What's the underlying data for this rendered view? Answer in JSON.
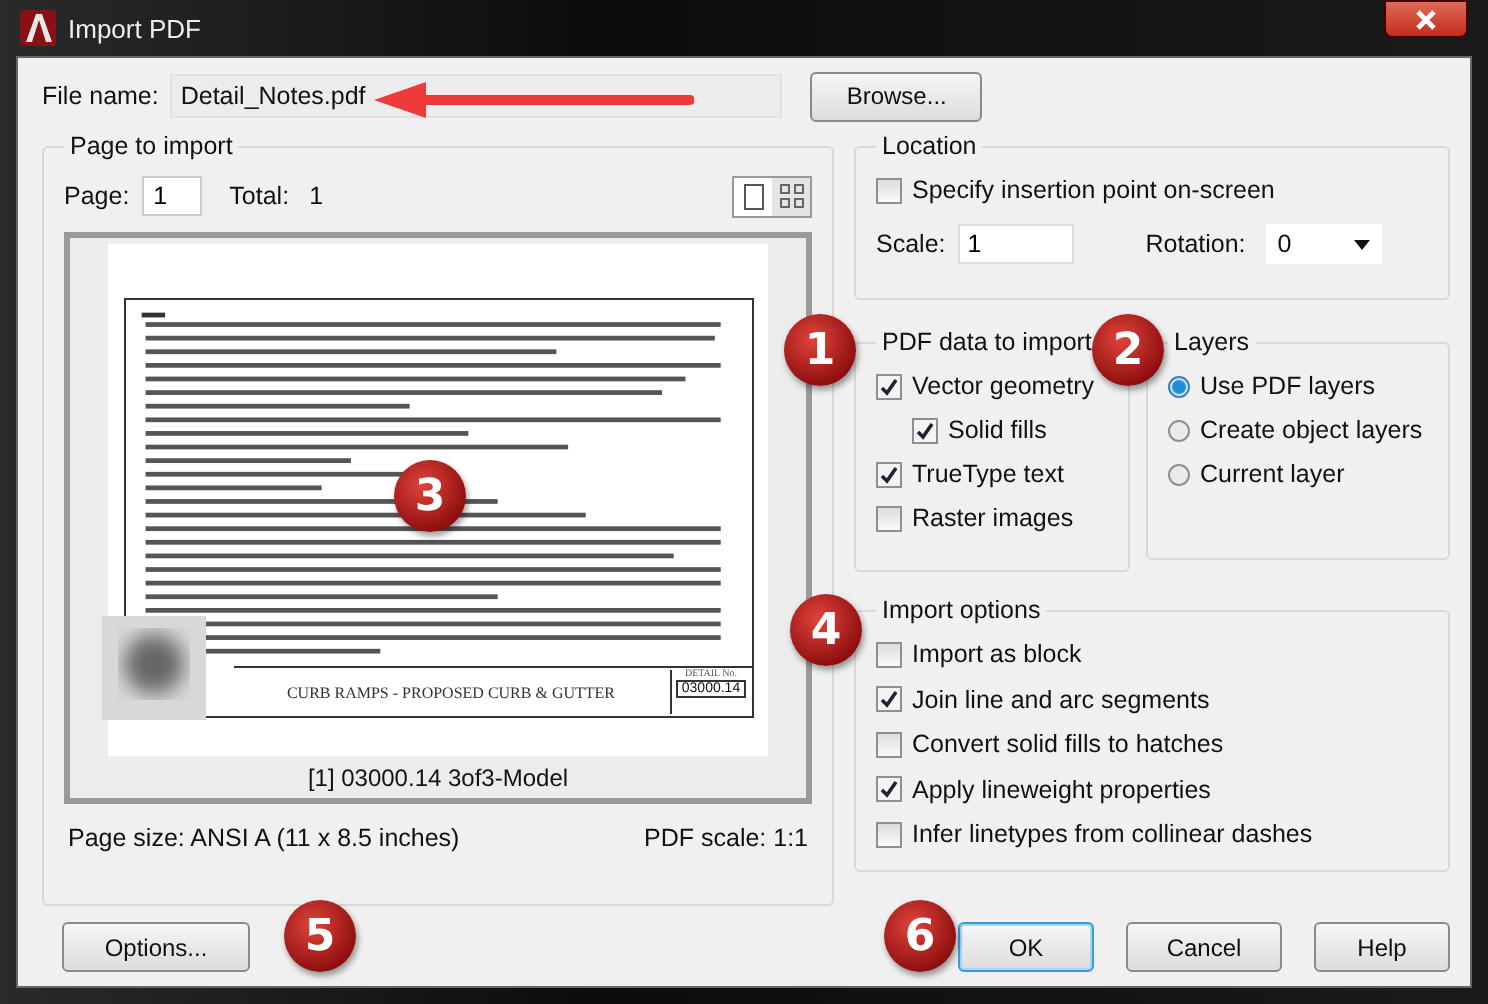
{
  "window": {
    "title": "Import PDF"
  },
  "file": {
    "label": "File name:",
    "value": "Detail_Notes.pdf",
    "browse": "Browse..."
  },
  "page_panel": {
    "legend": "Page to import",
    "page_label": "Page:",
    "page_value": "1",
    "total_label": "Total:",
    "total_value": "1",
    "view_modes": [
      {
        "kind": "single",
        "selected": true
      },
      {
        "kind": "grid",
        "selected": false
      }
    ],
    "preview": {
      "title_block": "CURB RAMPS - PROPOSED CURB & GUTTER",
      "detail_label": "DETAIL No.",
      "detail_number": "03000.14"
    },
    "caption": "[1] 03000.14 3of3-Model",
    "page_size": "Page size:  ANSI A (11 x 8.5 inches)",
    "pdf_scale": "PDF scale:  1:1"
  },
  "location": {
    "legend": "Location",
    "insertion_point": {
      "label": "Specify insertion point on-screen",
      "checked": false
    },
    "scale_label": "Scale:",
    "scale_value": "1",
    "rotation_label": "Rotation:",
    "rotation_value": "0"
  },
  "pdf_data": {
    "legend": "PDF data to import",
    "options": [
      {
        "label": "Vector geometry",
        "checked": true,
        "children": [
          {
            "label": "Solid fills",
            "checked": true
          }
        ]
      },
      {
        "label": "TrueType text",
        "checked": true
      },
      {
        "label": "Raster images",
        "checked": false
      }
    ]
  },
  "layers": {
    "legend": "Layers",
    "options": [
      {
        "label": "Use PDF layers",
        "selected": true
      },
      {
        "label": "Create object layers",
        "selected": false
      },
      {
        "label": "Current layer",
        "selected": false
      }
    ]
  },
  "import_options": {
    "legend": "Import options",
    "options": [
      {
        "label": "Import as block",
        "checked": false
      },
      {
        "label": "Join line and arc segments",
        "checked": true
      },
      {
        "label": "Convert solid fills to hatches",
        "checked": false
      },
      {
        "label": "Apply lineweight properties",
        "checked": true
      },
      {
        "label": "Infer linetypes from collinear dashes",
        "checked": false
      }
    ]
  },
  "buttons": [
    {
      "kind": "options",
      "label": "Options...",
      "focused": false
    },
    {
      "kind": "ok",
      "label": "OK",
      "focused": true
    },
    {
      "kind": "cancel",
      "label": "Cancel",
      "focused": false
    },
    {
      "kind": "help",
      "label": "Help",
      "focused": false
    }
  ],
  "callouts": [
    {
      "number": "1"
    },
    {
      "number": "2"
    },
    {
      "number": "3"
    },
    {
      "number": "4"
    },
    {
      "number": "5"
    },
    {
      "number": "6"
    }
  ]
}
